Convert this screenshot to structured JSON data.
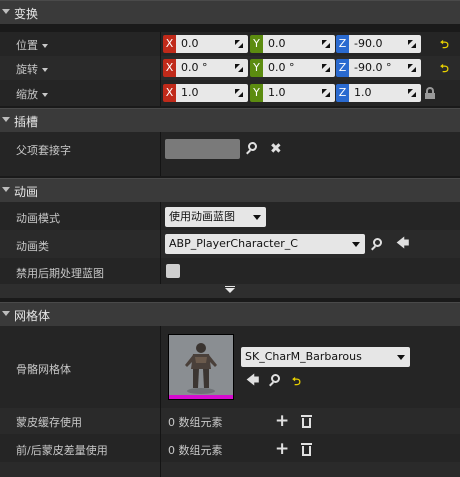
{
  "transform": {
    "header": "变换",
    "location": {
      "label": "位置",
      "x": "0.0",
      "y": "0.0",
      "z": "-90.0"
    },
    "rotation": {
      "label": "旋转",
      "x": "0.0 °",
      "y": "0.0 °",
      "z": "-90.0 °"
    },
    "scale": {
      "label": "缩放",
      "x": "1.0",
      "y": "1.0",
      "z": "1.0"
    },
    "axes": {
      "x": "X",
      "y": "Y",
      "z": "Z"
    },
    "reset_glyph": "⮌"
  },
  "sockets": {
    "header": "插槽",
    "parent_socket_label": "父项套接字",
    "parent_socket_value": ""
  },
  "animation": {
    "header": "动画",
    "mode_label": "动画模式",
    "mode_value": "使用动画蓝图",
    "class_label": "动画类",
    "class_value": "ABP_PlayerCharacter_C",
    "disable_post_label": "禁用后期处理蓝图",
    "disable_post_checked": false
  },
  "mesh": {
    "header": "网格体",
    "skeletal_mesh_label": "骨骼网格体",
    "skeletal_mesh_value": "SK_CharM_Barbarous",
    "skin_cache_label": "蒙皮缓存使用",
    "skin_cache_value": "0 数组元素",
    "pre_post_label": "前/后蒙皮差量使用",
    "pre_post_value": "0 数组元素"
  },
  "icons": {
    "search": "search-icon",
    "clear": "clear-icon",
    "use_selected": "arrow-left-icon",
    "add": "plus-icon",
    "delete": "trash-icon",
    "lock": "lock-icon"
  },
  "colors": {
    "axis_x": "#c02a1a",
    "axis_y": "#5c8c10",
    "axis_z": "#2a6ad0",
    "reset": "#e8d000",
    "thumbnail_bar": "#d60cd0"
  }
}
